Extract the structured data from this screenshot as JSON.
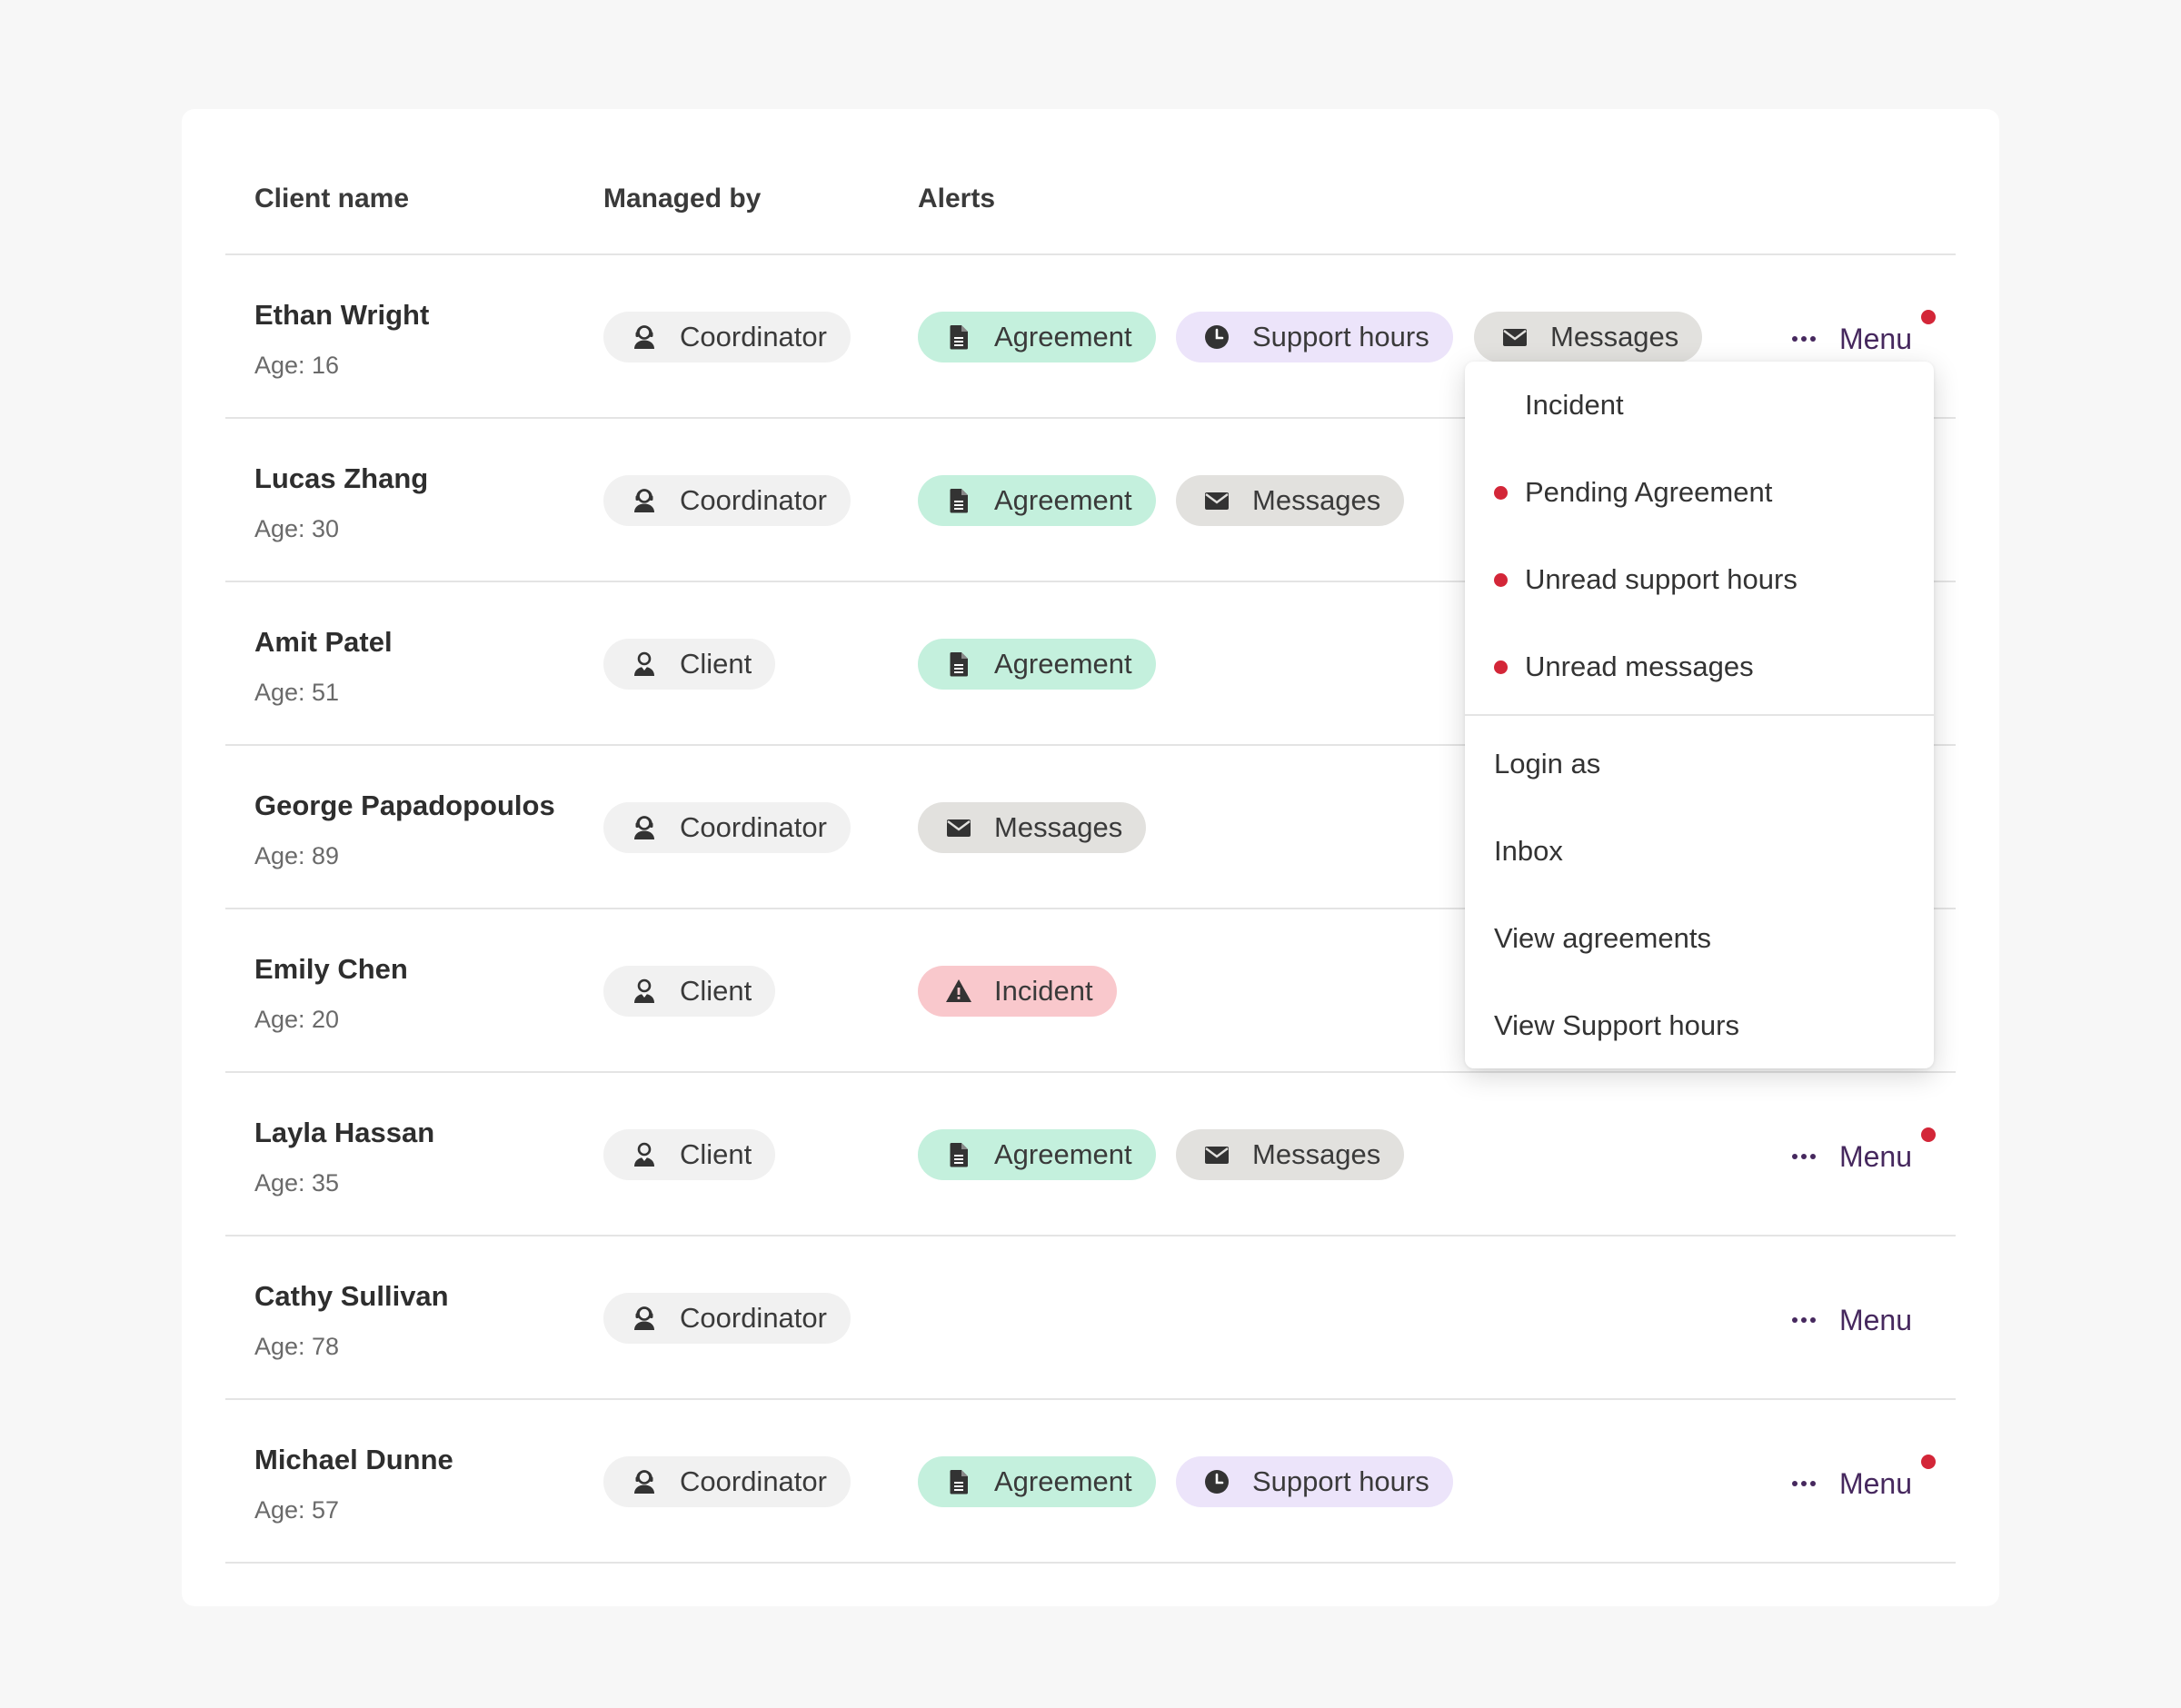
{
  "table": {
    "headers": {
      "client_name": "Client name",
      "managed_by": "Managed by",
      "alerts": "Alerts"
    },
    "menu_label": "Menu",
    "rows": [
      {
        "name": "Ethan Wright",
        "age": "Age: 16",
        "managed_by": "Coordinator",
        "alerts": [
          {
            "type": "agreement",
            "label": "Agreement"
          },
          {
            "type": "support",
            "label": "Support hours"
          },
          {
            "type": "messages",
            "label": "Messages"
          }
        ],
        "menu_visible": true,
        "menu_badge": true
      },
      {
        "name": "Lucas Zhang",
        "age": "Age: 30",
        "managed_by": "Coordinator",
        "alerts": [
          {
            "type": "agreement",
            "label": "Agreement"
          },
          {
            "type": "messages",
            "label": "Messages"
          }
        ],
        "menu_visible": false,
        "menu_badge": false
      },
      {
        "name": "Amit Patel",
        "age": "Age: 51",
        "managed_by": "Client",
        "alerts": [
          {
            "type": "agreement",
            "label": "Agreement"
          }
        ],
        "menu_visible": false,
        "menu_badge": false
      },
      {
        "name": "George Papadopoulos",
        "age": "Age: 89",
        "managed_by": "Coordinator",
        "alerts": [
          {
            "type": "messages",
            "label": "Messages"
          }
        ],
        "menu_visible": false,
        "menu_badge": false
      },
      {
        "name": "Emily Chen",
        "age": "Age: 20",
        "managed_by": "Client",
        "alerts": [
          {
            "type": "incident",
            "label": "Incident"
          }
        ],
        "menu_visible": false,
        "menu_badge": false
      },
      {
        "name": "Layla Hassan",
        "age": "Age: 35",
        "managed_by": "Client",
        "alerts": [
          {
            "type": "agreement",
            "label": "Agreement"
          },
          {
            "type": "messages",
            "label": "Messages"
          }
        ],
        "menu_visible": true,
        "menu_badge": true
      },
      {
        "name": "Cathy Sullivan",
        "age": "Age: 78",
        "managed_by": "Coordinator",
        "alerts": [],
        "menu_visible": true,
        "menu_badge": false
      },
      {
        "name": "Michael Dunne",
        "age": "Age: 57",
        "managed_by": "Coordinator",
        "alerts": [
          {
            "type": "agreement",
            "label": "Agreement"
          },
          {
            "type": "support",
            "label": "Support hours"
          }
        ],
        "menu_visible": true,
        "menu_badge": true
      }
    ]
  },
  "dropdown": {
    "alert_items": [
      {
        "label": "Incident",
        "dot": false
      },
      {
        "label": "Pending Agreement",
        "dot": true
      },
      {
        "label": "Unread support hours",
        "dot": true
      },
      {
        "label": "Unread messages",
        "dot": true
      }
    ],
    "action_items": [
      "Login as",
      "Inbox",
      "View agreements",
      "View Support hours"
    ]
  },
  "colors": {
    "agreement_bg": "#c4f0dd",
    "support_bg": "#ece4fa",
    "messages_bg": "#e2e1de",
    "incident_bg": "#f9c8cc",
    "manager_bg": "#f1f1f1",
    "menu_text": "#46285e",
    "badge": "#d32638"
  },
  "icons": {
    "coordinator": "headset-person-icon",
    "client": "person-icon",
    "agreement": "document-icon",
    "support": "clock-icon",
    "messages": "envelope-icon",
    "incident": "warning-triangle-icon",
    "menu": "more-dots-icon"
  }
}
